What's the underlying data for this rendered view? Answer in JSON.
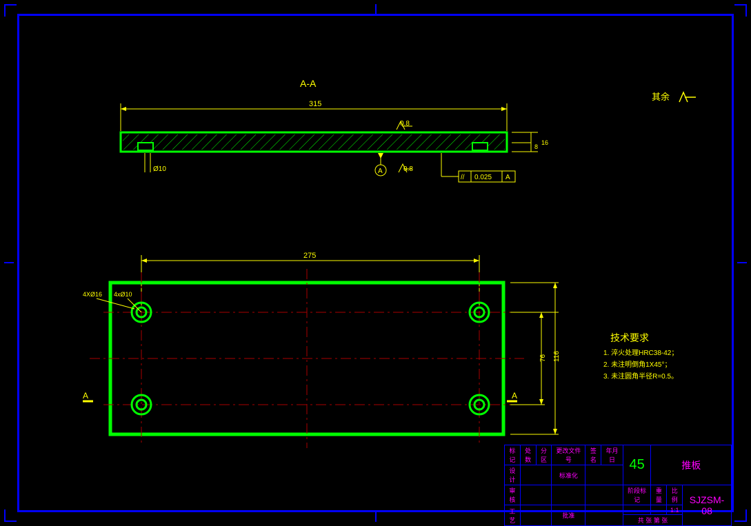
{
  "section": {
    "label": "A-A",
    "overall_length": "315",
    "dia_callout": "Ø10",
    "thickness": "16",
    "thickness2": "8",
    "surface_finish_top": "0.8",
    "surface_finish_bottom": "0.8",
    "datum": "A",
    "gdnt_value": "0.025",
    "gdnt_datum": "A"
  },
  "plan": {
    "hole_pitch_x": "275",
    "hole_pitch_y": "76",
    "overall_y": "116",
    "hole_label_1": "4XØ16",
    "hole_label_2": "4xØ10",
    "section_mark_left": "A",
    "section_mark_right": "A"
  },
  "notes": {
    "title": "技术要求",
    "items": [
      "1. 淬火处理HRC38-42；",
      "2. 未注明倒角1X45°；",
      "3. 未注圆角半径R=0.5。"
    ]
  },
  "general_finish": "其余",
  "titleblock": {
    "row1": [
      "标记",
      "处数",
      "分区",
      "更改文件号",
      "签名",
      "年月日"
    ],
    "row2_a": "设计",
    "row2_b": "标准化",
    "row3_a": "审核",
    "row4_a": "工艺",
    "row4_b": "批准",
    "material": "45",
    "part_name": "推板",
    "drawing_no": "SJZSM-08",
    "scale_label": "阶段标记",
    "weight_label": "重量",
    "ratio_label": "比例",
    "ratio_value": "1:1",
    "sheets": "共    张 第    张"
  }
}
